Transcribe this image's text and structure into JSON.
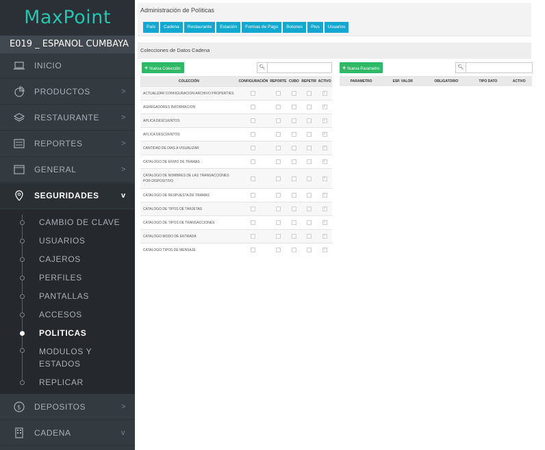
{
  "app": {
    "logo": "MaxPoint",
    "store": "E019 _ ESPANOL CUMBAYA"
  },
  "sidebar": {
    "items": [
      {
        "label": "INICIO",
        "icon": "laptop-icon",
        "chevron": ""
      },
      {
        "label": "PRODUCTOS",
        "icon": "pie-chart-icon",
        "chevron": ">"
      },
      {
        "label": "RESTAURANTE",
        "icon": "layers-icon",
        "chevron": ">"
      },
      {
        "label": "REPORTES",
        "icon": "list-icon",
        "chevron": ">"
      },
      {
        "label": "GENERAL",
        "icon": "window-icon",
        "chevron": ">"
      },
      {
        "label": "SEGURIDADES",
        "icon": "location-pin-icon",
        "chevron": "v"
      }
    ],
    "subitems": [
      "CAMBIO DE CLAVE",
      "USUARIOS",
      "CAJEROS",
      "PERFILES",
      "PANTALLAS",
      "ACCESOS",
      "POLITICAS",
      "MODULOS Y ESTADOS",
      "REPLICAR"
    ],
    "active_sub": "POLITICAS",
    "bottom": [
      {
        "label": "DEPOSITOS",
        "icon": "dollar-icon",
        "chevron": ">"
      },
      {
        "label": "CADENA",
        "icon": "building-icon",
        "chevron": "v"
      }
    ]
  },
  "header": {
    "title": "Administración de Políticas",
    "tabs": [
      "País",
      "Cadena",
      "Restaurante",
      "Estación",
      "Formas de Pago",
      "Botones",
      "Plus",
      "Usuarios"
    ]
  },
  "section": {
    "title": "Colecciones de Datos Cadena"
  },
  "left_panel": {
    "button": "Nueva Colección",
    "search_placeholder": "",
    "columns": [
      "COLECCIÓN",
      "CONFIGURACIÓN",
      "REPORTE",
      "CUBO",
      "REPETIR",
      "ACTIVO"
    ],
    "rows": [
      "ACTUALIZAR CONFIGURACION ARCHIVO PROPERTIES",
      "AGREGADORES INFORMACION",
      "APLICA DESCUENTOS",
      "APLICA DESCUENTOS",
      "CANTIDAD DE DIAS A VISUALIZAR",
      "CATALOGO DE ENVIO DE TRAMAS",
      "CATALOGO DE NOMBRES DE LAS TRANSACCIONES POR DISPOSITIVO",
      "CATALOGO DE RESPUESTA DE TRAMAS",
      "CATALOGO DE TIPOS DE TARJETAS",
      "CATALOGO DE TIPOS DE TRANSACCIONES",
      "CATALOGO MODO DE ENTRADA",
      "CATALOGO TIPOS DE MENSAJE"
    ]
  },
  "right_panel": {
    "button": "Nueva Parametro",
    "columns": [
      "PARAMETRO",
      "ESP. VALOR",
      "OBLIGATORIO",
      "TIPO DATO",
      "ACTIVO"
    ]
  },
  "colors": {
    "accent": "#27c5b0",
    "tab": "#12a8d0",
    "green": "#2fb865",
    "sidebar": "#333a40"
  }
}
